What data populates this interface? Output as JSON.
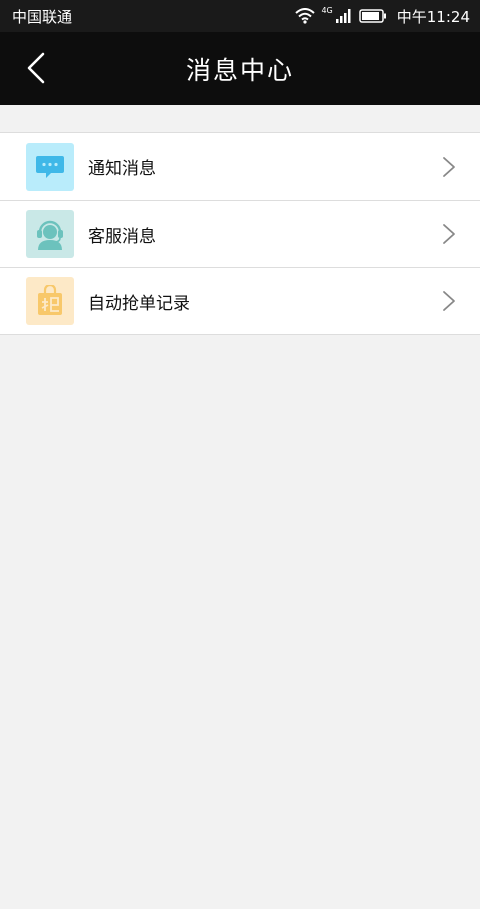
{
  "status_bar": {
    "carrier": "中国联通",
    "network": "4G",
    "time": "中午11:24"
  },
  "header": {
    "title": "消息中心"
  },
  "items": [
    {
      "label": "通知消息",
      "icon": "chat-bubble-icon",
      "icon_bg": "#b9ecfb",
      "icon_color": "#3fb8e8"
    },
    {
      "label": "客服消息",
      "icon": "customer-service-icon",
      "icon_bg": "#c9e8e7",
      "icon_color": "#6cc2bd"
    },
    {
      "label": "自动抢单记录",
      "icon": "grab-order-icon",
      "icon_bg": "#fde9c7",
      "icon_color": "#f8c86a"
    }
  ],
  "colors": {
    "header_bg": "#0d0d0d",
    "page_bg": "#f2f2f2",
    "divider": "#dddddd"
  }
}
